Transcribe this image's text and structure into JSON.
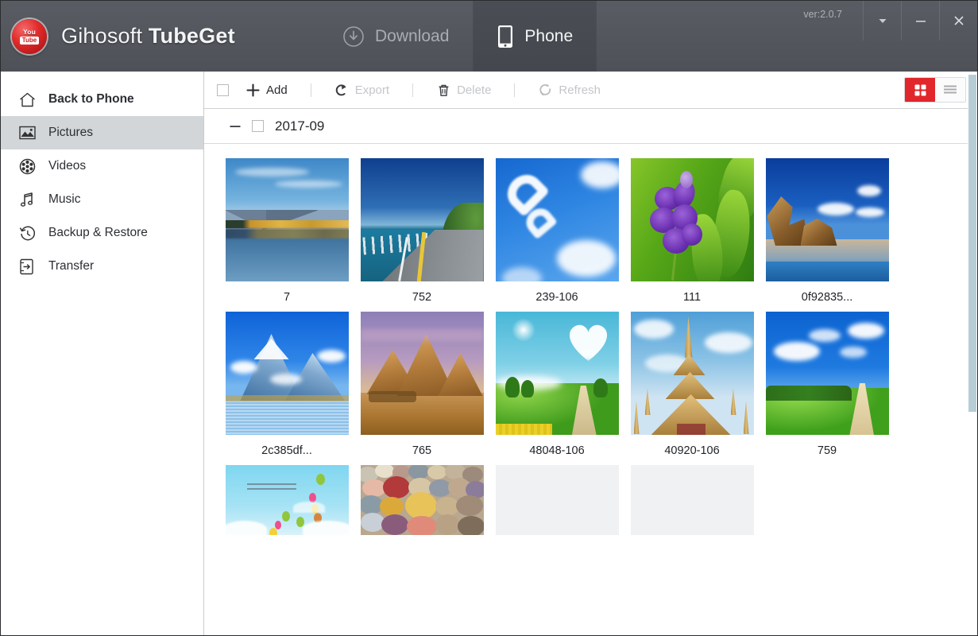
{
  "window": {
    "version_label": "ver:2.0.7",
    "controls": [
      {
        "name": "dropdown-button",
        "glyph": "▾"
      },
      {
        "name": "minimize-button",
        "glyph": "—"
      },
      {
        "name": "close-button",
        "glyph": "✕"
      }
    ]
  },
  "brand": {
    "logo_icon": "youtube-logo-icon",
    "logo_top_text": "You",
    "logo_bottom_text": "Tube",
    "name_light": "Gihosoft ",
    "name_bold": "TubeGet"
  },
  "header": {
    "tabs": [
      {
        "label": "Download",
        "icon": "download-circle-icon",
        "active": false
      },
      {
        "label": "Phone",
        "icon": "phone-icon",
        "active": true
      }
    ]
  },
  "sidebar": {
    "items": [
      {
        "label": "Back to Phone",
        "icon": "home-icon",
        "active": false,
        "bold": true
      },
      {
        "label": "Pictures",
        "icon": "pictures-icon",
        "active": true,
        "bold": false
      },
      {
        "label": "Videos",
        "icon": "film-reel-icon",
        "active": false,
        "bold": false
      },
      {
        "label": "Music",
        "icon": "music-note-icon",
        "active": false,
        "bold": false
      },
      {
        "label": "Backup & Restore",
        "icon": "history-clock-icon",
        "active": false,
        "bold": false
      },
      {
        "label": "Transfer",
        "icon": "transfer-icon",
        "active": false,
        "bold": false
      }
    ]
  },
  "toolbar": {
    "select_all_checked": false,
    "buttons": [
      {
        "label": "Add",
        "icon": "plus-icon",
        "enabled": true
      },
      {
        "label": "Export",
        "icon": "export-arrow-icon",
        "enabled": false
      },
      {
        "label": "Delete",
        "icon": "trash-icon",
        "enabled": false
      },
      {
        "label": "Refresh",
        "icon": "refresh-icon",
        "enabled": false
      }
    ],
    "view_modes": [
      {
        "name": "grid-view",
        "icon": "grid-icon",
        "active": true
      },
      {
        "name": "list-view",
        "icon": "list-icon",
        "active": false
      }
    ],
    "accent_color": "#e1262c"
  },
  "group": {
    "collapse_icon": "minus-icon",
    "checked": false,
    "label": "2017-09"
  },
  "gallery": {
    "items": [
      {
        "caption": "7",
        "art": "t1",
        "alt": "mountain-lake-reflection"
      },
      {
        "caption": "752",
        "art": "t2",
        "alt": "coastal-highway"
      },
      {
        "caption": "239-106",
        "art": "t3",
        "alt": "cloud-hearts-blue-sky"
      },
      {
        "caption": "111",
        "art": "t4",
        "alt": "purple-orchid"
      },
      {
        "caption": "0f92835...",
        "art": "t5",
        "alt": "rocky-beach"
      },
      {
        "caption": "2c385df...",
        "art": "t6",
        "alt": "snowy-mountain-lake"
      },
      {
        "caption": "765",
        "art": "t7",
        "alt": "egyptian-pyramids"
      },
      {
        "caption": "48048-106",
        "art": "t8",
        "alt": "heart-cloud-green-hills"
      },
      {
        "caption": "40920-106",
        "art": "t9",
        "alt": "golden-temple-stupa"
      },
      {
        "caption": "759",
        "art": "t10",
        "alt": "green-hills-path"
      },
      {
        "caption": "",
        "art": "t11",
        "alt": "balloons-sky-illustration"
      },
      {
        "caption": "",
        "art": "t12",
        "alt": "colorful-pebbles"
      },
      {
        "caption": "",
        "art": "empty",
        "alt": "empty-placeholder"
      },
      {
        "caption": "",
        "art": "empty",
        "alt": "empty-placeholder"
      }
    ]
  },
  "scrollbar": {
    "orientation": "vertical",
    "thumb_color": "#b6cdd6"
  }
}
